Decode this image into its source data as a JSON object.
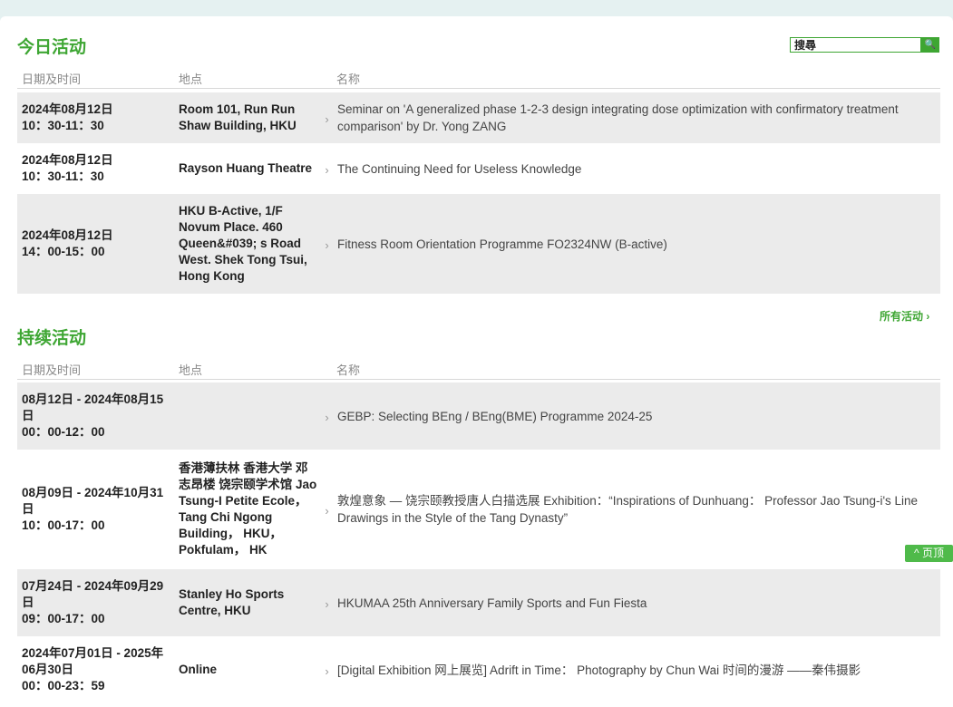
{
  "today": {
    "title": "今日活动",
    "search_value": "搜尋",
    "columns": {
      "date": "日期及时间",
      "venue": "地点",
      "name": "名称"
    },
    "rows": [
      {
        "date": "2024年08月12日\n10：30-11：30",
        "venue": "Room 101, Run Run Shaw Building, HKU",
        "name": "Seminar on 'A generalized phase 1-2-3 design integrating dose optimization with confirmatory treatment comparison' by Dr. Yong ZANG"
      },
      {
        "date": "2024年08月12日\n10：30-11：30",
        "venue": "Rayson Huang Theatre",
        "name": "The Continuing Need for Useless Knowledge"
      },
      {
        "date": "2024年08月12日\n14：00-15：00",
        "venue": "HKU B-Active, 1/F Novum Place. 460 Queen&#039; s Road West. Shek Tong Tsui, Hong Kong",
        "name": "Fitness Room Orientation Programme FO2324NW (B-active)"
      }
    ],
    "all_link": "所有活动 ›"
  },
  "ongoing": {
    "title": "持续活动",
    "columns": {
      "date": "日期及时间",
      "venue": "地点",
      "name": "名称"
    },
    "rows": [
      {
        "date": "08月12日 - 2024年08月15日\n00：00-12：00",
        "venue": "",
        "name": "GEBP: Selecting BEng / BEng(BME) Programme 2024-25"
      },
      {
        "date": "08月09日 - 2024年10月31日\n10：00-17：00",
        "venue": "香港薄扶林 香港大学 邓志昂楼 饶宗颐学术馆 Jao Tsung-I Petite Ecole， Tang Chi Ngong Building， HKU， Pokfulam， HK",
        "name": "敦煌意象 — 饶宗颐教授唐人白描选展 Exhibition：“Inspirations of Dunhuang： Professor Jao Tsung-i's Line Drawings in the Style of the Tang Dynasty”"
      },
      {
        "date": "07月24日 - 2024年09月29日\n09：00-17：00",
        "venue": "Stanley Ho Sports Centre, HKU",
        "name": "HKUMAA 25th Anniversary Family Sports and Fun Fiesta"
      },
      {
        "date": "2024年07月01日 - 2025年06月30日\n00：00-23：59",
        "venue": "Online",
        "name": "[Digital Exhibition 网上展览] Adrift in Time： Photography by Chun Wai 时间的漫游 ——秦伟摄影"
      }
    ]
  },
  "back_to_top": "^ 页顶",
  "accent_color": "#3ea633",
  "icons": {
    "search": "search-icon",
    "arrow": "chevron-right-icon"
  }
}
